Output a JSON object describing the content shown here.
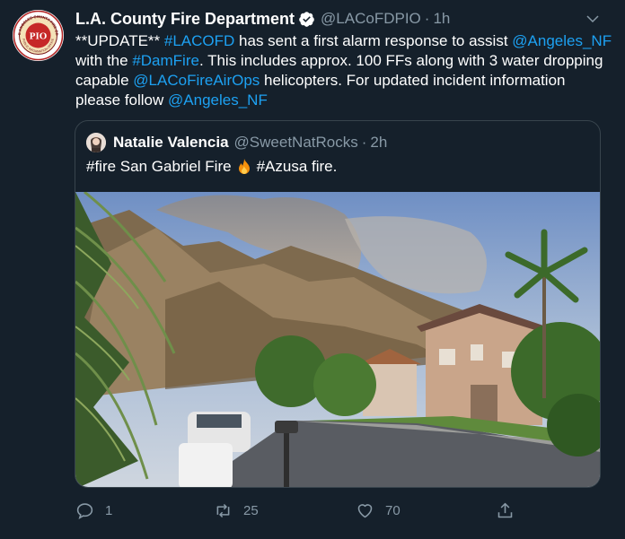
{
  "tweet": {
    "author": {
      "name": "L.A. County Fire Department",
      "handle": "@LACoFDPIO",
      "time": "1h",
      "avatar_text": "PIO",
      "avatar_ring_text": "LOS ANGELES COUNTY FIRE DEPT",
      "avatar_ring_text_bottom": "PUBLIC INFORMATION OFFICE",
      "verified_icon": "verified-badge-icon"
    },
    "separator": "·",
    "text": {
      "p1": "**UPDATE** ",
      "link1": "#LACOFD",
      "p2": " has sent a first alarm response to assist ",
      "link2": "@Angeles_NF",
      "p3": " with the ",
      "link3": "#DamFire",
      "p4": ".  This includes approx. 100 FFs along with 3 water dropping capable ",
      "link4": "@LACoFireAirOps",
      "p5": " helicopters.  For updated incident information please follow ",
      "link5": "@Angeles_NF"
    },
    "quote": {
      "name": "Natalie Valencia",
      "handle": "@SweetNatRocks",
      "time": "2h",
      "text_before": "#fire San Gabriel Fire",
      "emoji": "fire-emoji-icon",
      "text_after": "#Azusa fire."
    },
    "actions": {
      "replies": "1",
      "retweets": "25",
      "likes": "70"
    }
  },
  "colors": {
    "background": "#15202b",
    "link": "#1da1f2",
    "muted": "#8899a6",
    "border": "#38444d"
  }
}
